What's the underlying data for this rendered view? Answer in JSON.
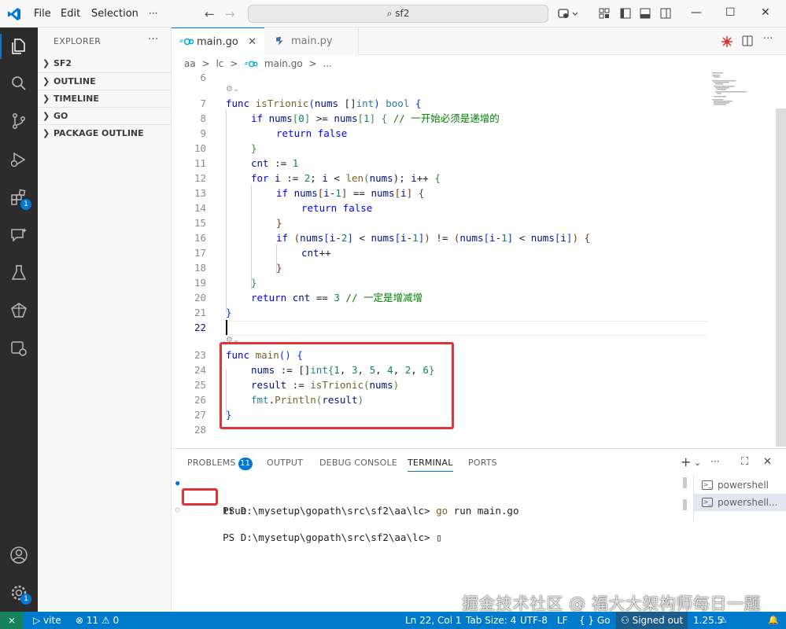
{
  "menu": {
    "file": "File",
    "edit": "Edit",
    "selection": "Selection",
    "more": "···"
  },
  "search": {
    "text": "sf2"
  },
  "window": {
    "minimize": "—",
    "maximize": "☐",
    "close": "✕"
  },
  "sidebar": {
    "header": "EXPLORER",
    "more": "···",
    "sections": [
      {
        "label": "SF2"
      },
      {
        "label": "OUTLINE"
      },
      {
        "label": "TIMELINE"
      },
      {
        "label": "GO"
      },
      {
        "label": "PACKAGE OUTLINE"
      }
    ]
  },
  "activity": {
    "extensions_badge": "1",
    "settings_badge": "1"
  },
  "tabs": [
    {
      "label": "main.go",
      "close": "✕"
    },
    {
      "label": "main.py"
    }
  ],
  "breadcrumb": {
    "parts": [
      "aa",
      ">",
      "lc",
      ">",
      "main.go",
      ">",
      "..."
    ]
  },
  "editor": {
    "line_numbers": [
      "6",
      "7",
      "8",
      "9",
      "10",
      "11",
      "12",
      "13",
      "14",
      "15",
      "16",
      "17",
      "18",
      "19",
      "20",
      "21",
      "22",
      "23",
      "24",
      "25",
      "26",
      "27",
      "28"
    ],
    "codelens_1": "⚙⌄",
    "codelens_2": "⚙⌄",
    "code": {
      "l7": [
        "func",
        " ",
        "isTrionic",
        "(",
        "nums",
        " ",
        "[]",
        "int",
        ")",
        " ",
        "bool",
        " ",
        "{"
      ],
      "l8": [
        "if",
        " ",
        "nums",
        "[",
        "0",
        "]",
        " >= ",
        "nums",
        "[",
        "1",
        "]",
        " ",
        "{",
        " // 一开始必须是递增的"
      ],
      "l9": [
        "return",
        " ",
        "false"
      ],
      "l10": [
        "}"
      ],
      "l11": [
        "cnt",
        " := ",
        "1"
      ],
      "l12": [
        "for",
        " ",
        "i",
        " := ",
        "2",
        "; ",
        "i",
        " < ",
        "len",
        "(",
        "nums",
        "); ",
        "i",
        "++ ",
        "{"
      ],
      "l13": [
        "if",
        " ",
        "nums",
        "[",
        "i",
        "-",
        "1",
        "]",
        " == ",
        "nums",
        "[",
        "i",
        "]",
        " ",
        "{"
      ],
      "l14": [
        "return",
        " ",
        "false"
      ],
      "l15": [
        "}"
      ],
      "l16": [
        "if",
        " ",
        "(",
        "nums",
        "[",
        "i",
        "-",
        "2",
        "]",
        " < ",
        "nums",
        "[",
        "i",
        "-",
        "1",
        "]",
        ")",
        " != ",
        "(",
        "nums",
        "[",
        "i",
        "-",
        "1",
        "]",
        " < ",
        "nums",
        "[",
        "i",
        "]",
        ")",
        " ",
        "{"
      ],
      "l17": [
        "cnt",
        "++"
      ],
      "l18": [
        "}"
      ],
      "l19": [
        "}"
      ],
      "l20": [
        "return",
        " ",
        "cnt",
        " == ",
        "3",
        " // 一定是增减增"
      ],
      "l21": [
        "}"
      ],
      "l23": [
        "func",
        " ",
        "main",
        "()",
        " ",
        "{"
      ],
      "l24": [
        "nums",
        " := ",
        "[]",
        "int",
        "{",
        "1",
        ", ",
        "3",
        ", ",
        "5",
        ", ",
        "4",
        ", ",
        "2",
        ", ",
        "6",
        "}"
      ],
      "l25": [
        "result",
        " := ",
        "isTrionic",
        "(",
        "nums",
        ")"
      ],
      "l26": [
        "fmt",
        ".",
        "Println",
        "(",
        "result",
        ")"
      ],
      "l27": [
        "}"
      ]
    }
  },
  "panel": {
    "tabs": {
      "problems": "PROBLEMS",
      "problems_count": "11",
      "output": "OUTPUT",
      "debug": "DEBUG CONSOLE",
      "terminal": "TERMINAL",
      "ports": "PORTS"
    },
    "actions": {
      "add": "+",
      "dropdown": "⌄",
      "more": "···",
      "maximize": "⛶",
      "close": "✕"
    },
    "terminal_lines": [
      {
        "prompt": "PS D:\\mysetup\\gopath\\src\\sf2\\aa\\lc> ",
        "cmd": "go",
        "args": " run main.go"
      },
      {
        "output": "true"
      },
      {
        "prompt": "PS D:\\mysetup\\gopath\\src\\sf2\\aa\\lc> ",
        "cursor": "▯"
      }
    ],
    "terminal_list": [
      {
        "label": "powershell"
      },
      {
        "label": "powershell..."
      }
    ]
  },
  "watermark": "掘金技术社区 @ 福大大架构师每日一题",
  "status": {
    "remote": "⨯",
    "vite": "vite",
    "problems": "⊗ 11  ⚠ 0",
    "position": "Ln 22, Col 1",
    "tabsize": "Tab Size: 4",
    "encoding": "UTF-8",
    "eol": "LF",
    "language": "{ } Go",
    "signed_out": "Signed out",
    "version": "1.25.5",
    "bell": "🔔"
  },
  "colors": {
    "accent": "#0078d4",
    "statusbar": "#007acc",
    "highlight": "#e0333a"
  }
}
